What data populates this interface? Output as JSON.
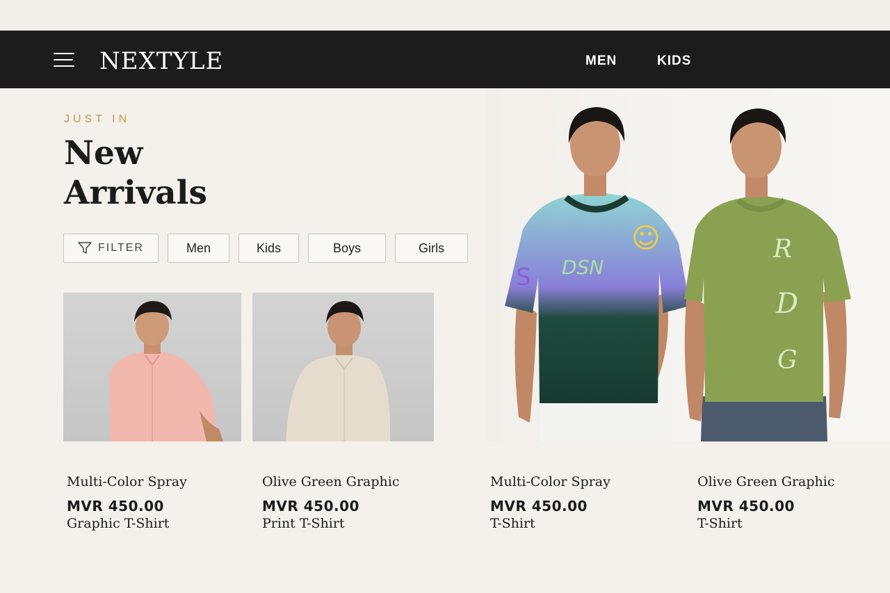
{
  "header": {
    "brand": "NEXTYLE",
    "nav": [
      "MEN",
      "KIDS"
    ],
    "menu_icon": "hamburger-menu-icon"
  },
  "hero": {
    "eyebrow": "JUST IN",
    "title_line1": "New",
    "title_line2": "Arrivals"
  },
  "filters": {
    "filter_label": "FILTER",
    "filter_icon": "funnel-icon",
    "chips": [
      "Men",
      "Kids",
      "Boys",
      "Girls"
    ]
  },
  "products": [
    {
      "title_line1": "Multi-Color Spray",
      "title_line2": "Graphic T-Shirt",
      "price": "MVR 450.00"
    },
    {
      "title_line1": "Olive Green Graphic",
      "title_line2": "Print T-Shirt",
      "price": "MVR 450.00"
    },
    {
      "title_line1": "Multi-Color Spray",
      "title_line2": "T-Shirt",
      "price": "MVR 450.00"
    },
    {
      "title_line1": "Olive Green Graphic",
      "title_line2": "T-Shirt",
      "price": "MVR 450.00"
    }
  ],
  "colors": {
    "nav_bg": "#1c1c1c",
    "accent": "#c2994a",
    "page_bg": "#f4f1ec"
  }
}
